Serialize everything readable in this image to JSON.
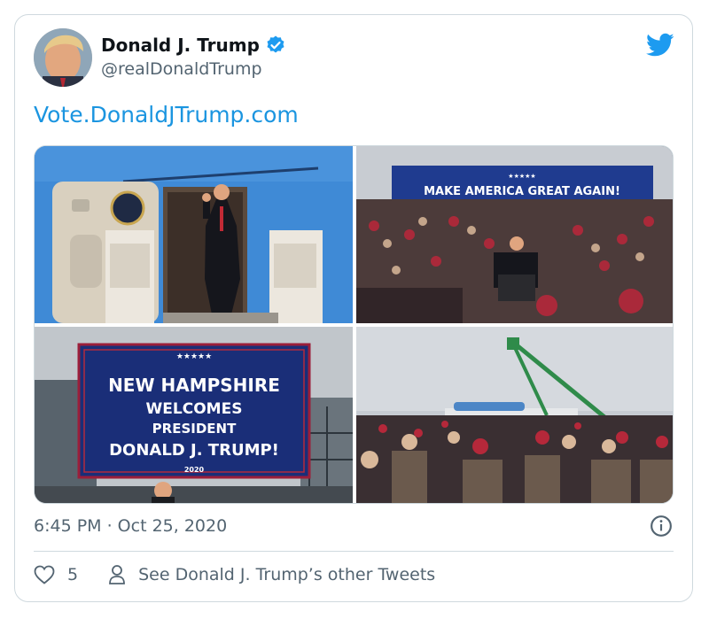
{
  "tweet": {
    "author_name": "Donald J. Trump",
    "author_handle": "@realDonaldTrump",
    "link_text": "Vote.DonaldJTrump.com",
    "timestamp": "6:45 PM · Oct 25, 2020",
    "like_count": "5",
    "other_tweets_label": "See Donald J. Trump’s other Tweets"
  },
  "photos": {
    "rally_banner": "MAKE AMERICA GREAT AGAIN!",
    "nh_sign": {
      "line1": "NEW HAMPSHIRE",
      "line2": "WELCOMES",
      "line3": "PRESIDENT",
      "line4": "DONALD J. TRUMP!",
      "year": "2020",
      "stars": "★★★★★"
    }
  },
  "colors": {
    "accent": "#1b95e0",
    "text": "#0f1419",
    "secondary": "#536471",
    "border": "#cfd9de"
  },
  "icons": [
    "verified-badge-icon",
    "twitter-bird-icon",
    "info-icon",
    "heart-icon",
    "person-icon"
  ]
}
